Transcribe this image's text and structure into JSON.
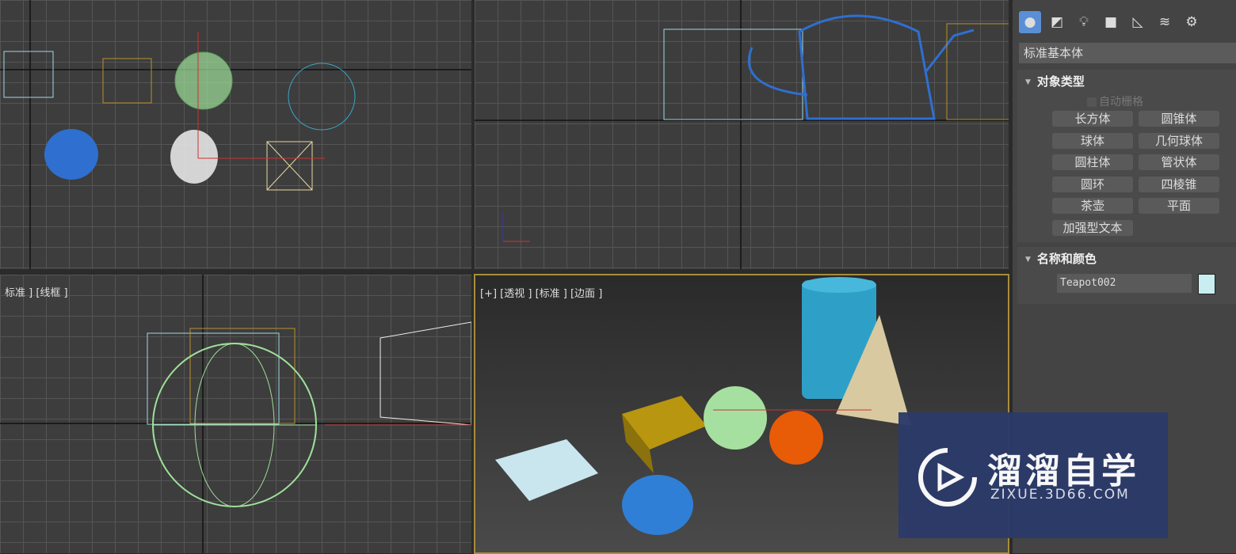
{
  "viewports": {
    "left_label": "标准 ] [线框 ]",
    "perspective_label": "[+] [透视 ] [标准 ] [边面 ]"
  },
  "command_panel": {
    "tabs_icons": [
      "geometry-icon",
      "shapes-icon",
      "lights-icon",
      "cameras-icon",
      "helpers-icon",
      "spacewarps-icon",
      "systems-icon"
    ],
    "category": "标准基本体",
    "object_type": {
      "title": "对象类型",
      "autogrid": "自动栅格",
      "buttons": [
        "长方体",
        "圆锥体",
        "球体",
        "几何球体",
        "圆柱体",
        "管状体",
        "圆环",
        "四棱锥",
        "茶壶",
        "平面",
        "加强型文本"
      ]
    },
    "name_color": {
      "title": "名称和颜色",
      "name": "Teapot002",
      "color": "#c8eef2"
    }
  },
  "watermark": {
    "title": "溜溜自学",
    "url": "ZIXUE.3D66.COM"
  }
}
